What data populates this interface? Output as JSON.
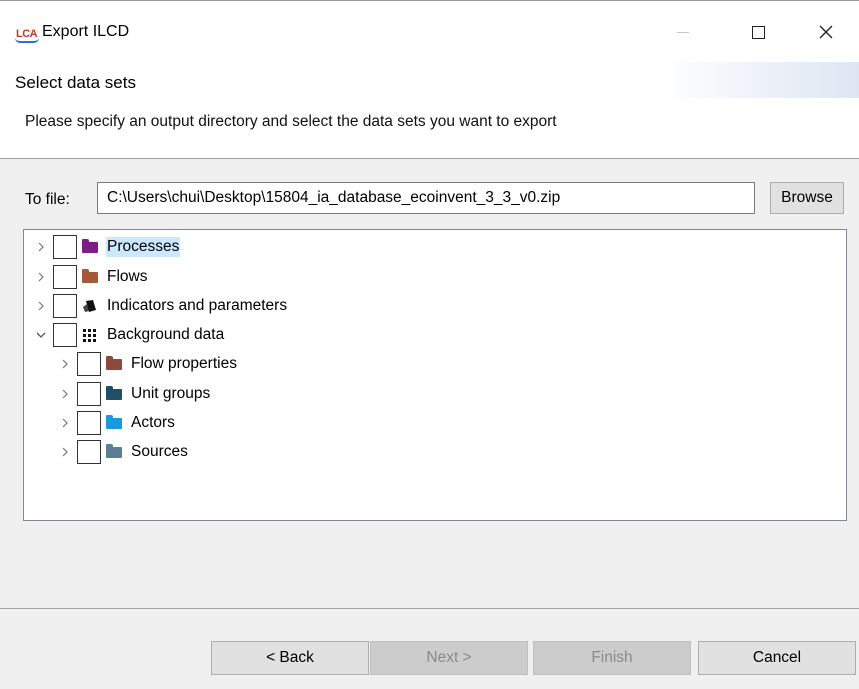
{
  "window": {
    "app_icon_text": "LCA",
    "title": "Export ILCD",
    "close_glyph": "✕"
  },
  "header": {
    "title": "Select data sets",
    "description": "Please specify an output directory and select the data sets you want to export"
  },
  "file": {
    "label": "To file:",
    "value": "C:\\Users\\chui\\Desktop\\15804_ia_database_ecoinvent_3_3_v0.zip",
    "browse_label": "Browse"
  },
  "tree": {
    "items": [
      {
        "label": "Processes",
        "icon": "folder-icon",
        "color": "#7b1f87",
        "expanded": false,
        "selected": true
      },
      {
        "label": "Flows",
        "icon": "folder-icon",
        "color": "#a5593b",
        "expanded": false,
        "selected": false
      },
      {
        "label": "Indicators and parameters",
        "icon": "indicators-icon",
        "color": "#111111",
        "expanded": false,
        "selected": false
      },
      {
        "label": "Background data",
        "icon": "grid-icon",
        "color": "#111111",
        "expanded": true,
        "selected": false,
        "children": [
          {
            "label": "Flow properties",
            "icon": "folder-icon",
            "color": "#8b4a3c"
          },
          {
            "label": "Unit groups",
            "icon": "folder-icon",
            "color": "#1f4e6b"
          },
          {
            "label": "Actors",
            "icon": "folder-icon",
            "color": "#1a9ad6"
          },
          {
            "label": "Sources",
            "icon": "folder-icon",
            "color": "#5a7f95"
          }
        ]
      }
    ]
  },
  "footer": {
    "back_label": "< Back",
    "next_label": "Next >",
    "finish_label": "Finish",
    "cancel_label": "Cancel"
  }
}
